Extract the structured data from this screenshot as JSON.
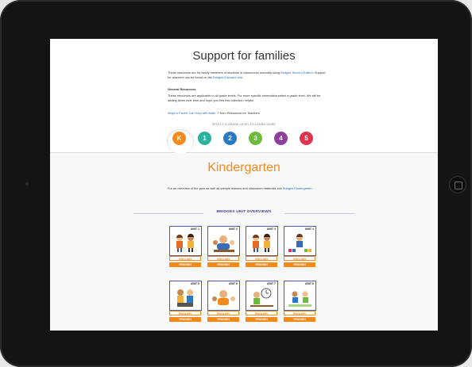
{
  "page": {
    "title": "Support for families",
    "intro_line1": "These resources are for family members of students in classrooms currently using",
    "intro_link1": "Bridges Second Edition",
    "intro_line1b": ". Support for teachers can be found on the",
    "intro_link2": "Bridges Educator site",
    "intro_line1c": ".",
    "general_heading": "General Resources",
    "general_text": "These resources are applicable to all grade levels. For more specific information select a grade level. We will be adding items over time and hope you find this collection helpful.",
    "parent_link": "Ways a Parent Can Help with Math",
    "parent_suffix": "from Resources for Teachers",
    "select_label": "SELECT A GRADE LEVEL TO LEARN MORE"
  },
  "grades": [
    {
      "label": "K",
      "color": "#f28a1c"
    },
    {
      "label": "1",
      "color": "#2bb3a0"
    },
    {
      "label": "2",
      "color": "#2a79c3"
    },
    {
      "label": "3",
      "color": "#6dbb3a"
    },
    {
      "label": "4",
      "color": "#8f3e9e"
    },
    {
      "label": "5",
      "color": "#e0344e"
    }
  ],
  "kindergarten": {
    "title": "Kindergarten",
    "desc_line": "For an overview of the year as well as sample lessons and classroom materials",
    "desc_prefix": "see",
    "desc_link": "Bridges Kindergarten",
    "desc_suffix": "."
  },
  "overviews": {
    "heading": "BRIDGES UNIT OVERVIEWS",
    "english_label": "ENGLISH",
    "spanish_label": "SPANISH",
    "units": [
      "UNIT 1",
      "UNIT 2",
      "UNIT 3",
      "UNIT 4",
      "UNIT 5",
      "UNIT 6",
      "UNIT 7",
      "UNIT 8"
    ]
  }
}
